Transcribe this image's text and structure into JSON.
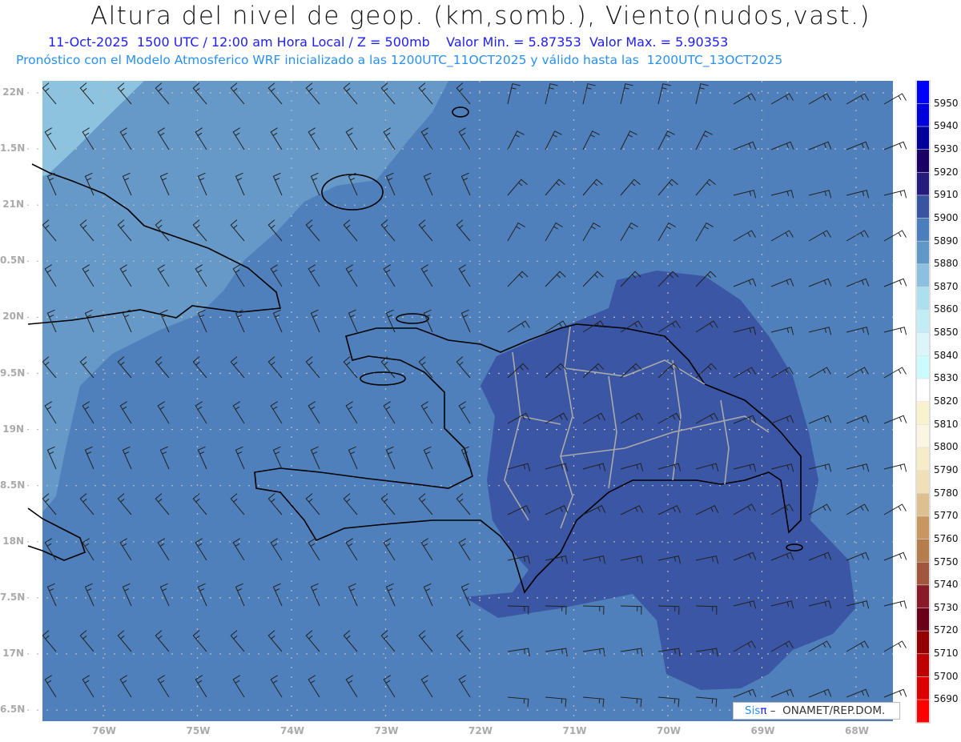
{
  "header": {
    "title": "Altura del nivel de geop. (km,somb.), Viento(nudos,vast.)",
    "subtitle": "11-Oct-2025  1500 UTC / 12:00 am Hora Local / Z = 500mb    Valor Min. = 5.87353  Valor Max. = 5.90353",
    "model_info": "Pronóstico con el Modelo Atmosferico WRF inicializado a las 1200UTC_11OCT2025 y válido hasta las  1200UTC_13OCT2025"
  },
  "axes": {
    "lat_labels": [
      "22N",
      "1.5N",
      "21N",
      "0.5N",
      "20N",
      "9.5N",
      "19N",
      "8.5N",
      "18N",
      "7.5N",
      "17N",
      "6.5N"
    ],
    "lon_labels": [
      "76W",
      "75W",
      "74W",
      "73W",
      "72W",
      "71W",
      "70W",
      "69W",
      "68W"
    ]
  },
  "colorbar": {
    "labels": [
      "5950",
      "5940",
      "5930",
      "5920",
      "5910",
      "5900",
      "5890",
      "5880",
      "5870",
      "5860",
      "5850",
      "5840",
      "5830",
      "5820",
      "5810",
      "5800",
      "5790",
      "5780",
      "5770",
      "5760",
      "5750",
      "5740",
      "5730",
      "5720",
      "5710",
      "5700",
      "5690"
    ],
    "colors": [
      "#0000ff",
      "#0000dd",
      "#00009a",
      "#1a0066",
      "#261c7e",
      "#3a55a0",
      "#4a7fbb",
      "#6098c8",
      "#8cc0de",
      "#addfee",
      "#c3edf5",
      "#dcf5fa",
      "#ccfbfd",
      "#ffffff",
      "#f8f2cf",
      "#faf6e4",
      "#f6ecc8",
      "#efe0b8",
      "#dcc08f",
      "#c8975f",
      "#b57d4c",
      "#a0573d",
      "#891a28",
      "#6a0018",
      "#930000",
      "#bd0000",
      "#dd0000",
      "#ff0000"
    ]
  },
  "map_colors": {
    "base": "#4f80bb",
    "light": "#6699c8",
    "lightest": "#8ec3df",
    "dark": "#3a56a4"
  },
  "credit": {
    "sis": "Sis",
    "pi": "π",
    "rest": " –  ONAMET/REP.DOM."
  }
}
